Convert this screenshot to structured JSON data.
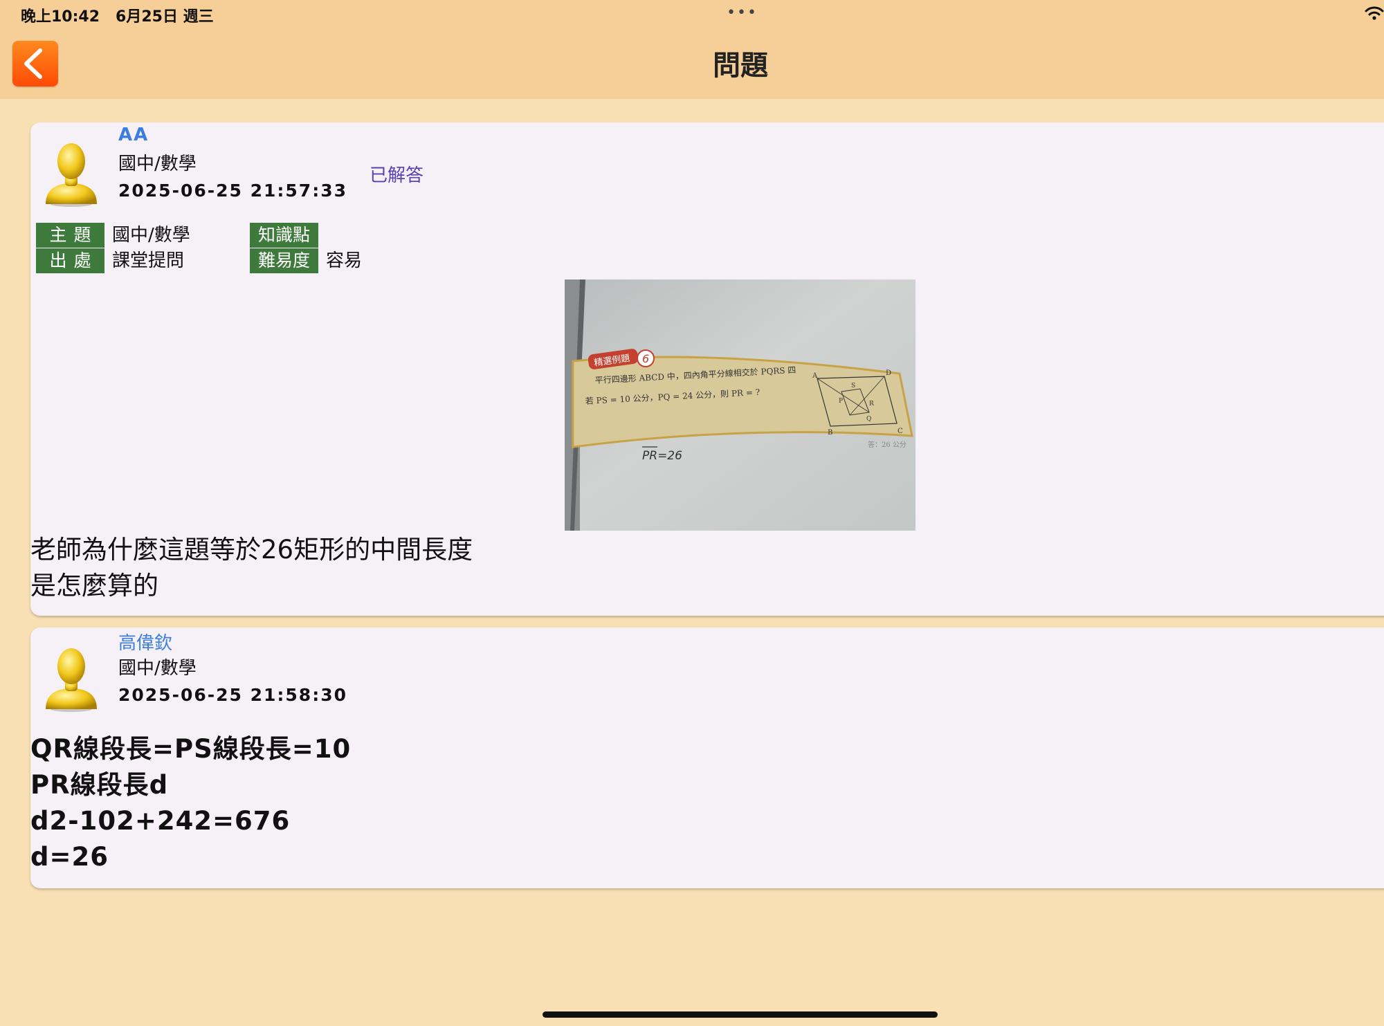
{
  "status_bar": {
    "time": "晚上10:42",
    "date": "6月25日 週三",
    "dots": "•••",
    "wifi_icon": "wifi-icon"
  },
  "nav": {
    "back_icon": "chevron-left-icon",
    "title": "問題"
  },
  "question": {
    "author": "AA",
    "subject": "國中/數學",
    "datetime": "2025-06-25 21:57:33",
    "status": "已解答",
    "tags": {
      "topic_label": "主題",
      "topic_value": "國中/數學",
      "source_label": "出處",
      "source_value": "課堂提問",
      "knowledge_label": "知識點",
      "knowledge_value": "",
      "difficulty_label": "難易度",
      "difficulty_value": "容易"
    },
    "photo": {
      "badge": "精選例題",
      "badge_number": "6",
      "line1": "平行四邊形 ABCD 中，四內角平分線相交於 PQRS 四",
      "line2": "若 PS = 10 公分，PQ = 24 公分，則 PR = ?",
      "answer_key": "答：26 公分",
      "handwriting": "PR=26",
      "diagram_labels": [
        "A",
        "B",
        "C",
        "D",
        "P",
        "Q",
        "R",
        "S"
      ]
    },
    "body_lines": [
      "老師為什麼這題等於26矩形的中間長度",
      "是怎麼算的"
    ]
  },
  "answer": {
    "author": "高偉欽",
    "subject": "國中/數學",
    "datetime": "2025-06-25 21:58:30",
    "body_lines": [
      "QR線段長=PS線段長=10",
      "PR線段長d",
      "d2-102+242=676",
      "d=26"
    ]
  },
  "colors": {
    "background": "#f8dfb4",
    "nav_bar": "#f6cf98",
    "card": "#f6f1f6",
    "author_link": "#3b7de0",
    "answered": "#5a3fb3",
    "tag_bg": "#3e7a3c",
    "back_button": "#ff5a0a"
  }
}
